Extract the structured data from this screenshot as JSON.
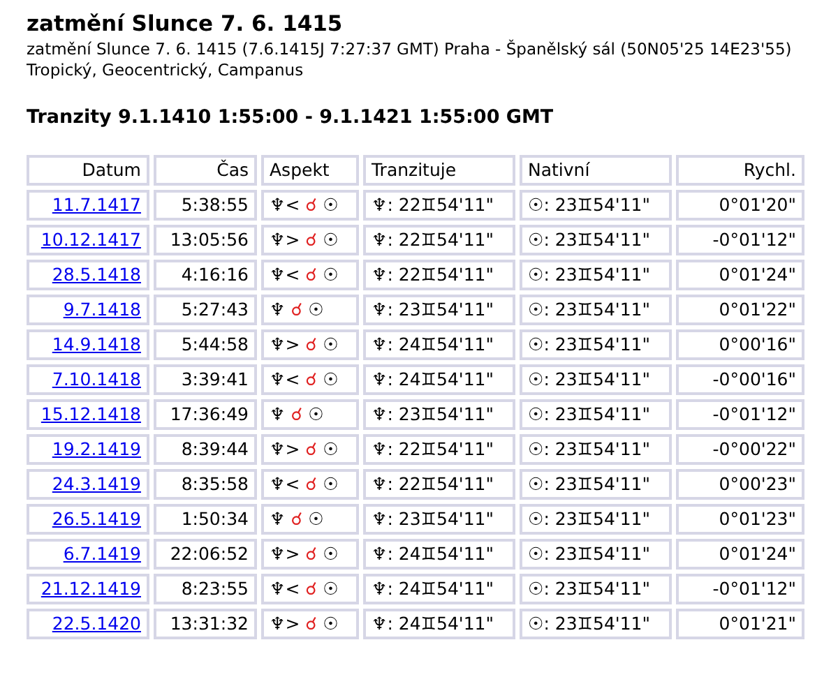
{
  "title": "zatmění Slunce 7. 6. 1415",
  "subtitle": "zatmění Slunce 7. 6. 1415 (7.6.1415J 7:27:37 GMT) Praha - Španělský sál (50N05'25 14E23'55)",
  "settings": "Tropický, Geocentrický, Campanus",
  "heading": "Tranzity 9.1.1410 1:55:00 - 9.1.1421 1:55:00 GMT",
  "table": {
    "columns": [
      "Datum",
      "Čas",
      "Aspekt",
      "Tranzituje",
      "Nativní",
      "Rychl."
    ],
    "rows": [
      {
        "date": "11.7.1417",
        "time": "5:38:55",
        "transit": "♆<",
        "aspect": "☌",
        "natal": "☉",
        "transiting": "♆: 22♊54'11\"",
        "native": "☉: 23♊54'11\"",
        "speed": "0°01'20\""
      },
      {
        "date": "10.12.1417",
        "time": "13:05:56",
        "transit": "♆>",
        "aspect": "☌",
        "natal": "☉",
        "transiting": "♆: 22♊54'11\"",
        "native": "☉: 23♊54'11\"",
        "speed": "-0°01'12\""
      },
      {
        "date": "28.5.1418",
        "time": "4:16:16",
        "transit": "♆<",
        "aspect": "☌",
        "natal": "☉",
        "transiting": "♆: 22♊54'11\"",
        "native": "☉: 23♊54'11\"",
        "speed": "0°01'24\""
      },
      {
        "date": "9.7.1418",
        "time": "5:27:43",
        "transit": "♆",
        "aspect": "☌",
        "natal": "☉",
        "transiting": "♆: 23♊54'11\"",
        "native": "☉: 23♊54'11\"",
        "speed": "0°01'22\""
      },
      {
        "date": "14.9.1418",
        "time": "5:44:58",
        "transit": "♆>",
        "aspect": "☌",
        "natal": "☉",
        "transiting": "♆: 24♊54'11\"",
        "native": "☉: 23♊54'11\"",
        "speed": "0°00'16\""
      },
      {
        "date": "7.10.1418",
        "time": "3:39:41",
        "transit": "♆<",
        "aspect": "☌",
        "natal": "☉",
        "transiting": "♆: 24♊54'11\"",
        "native": "☉: 23♊54'11\"",
        "speed": "-0°00'16\""
      },
      {
        "date": "15.12.1418",
        "time": "17:36:49",
        "transit": "♆",
        "aspect": "☌",
        "natal": "☉",
        "transiting": "♆: 23♊54'11\"",
        "native": "☉: 23♊54'11\"",
        "speed": "-0°01'12\""
      },
      {
        "date": "19.2.1419",
        "time": "8:39:44",
        "transit": "♆>",
        "aspect": "☌",
        "natal": "☉",
        "transiting": "♆: 22♊54'11\"",
        "native": "☉: 23♊54'11\"",
        "speed": "-0°00'22\""
      },
      {
        "date": "24.3.1419",
        "time": "8:35:58",
        "transit": "♆<",
        "aspect": "☌",
        "natal": "☉",
        "transiting": "♆: 22♊54'11\"",
        "native": "☉: 23♊54'11\"",
        "speed": "0°00'23\""
      },
      {
        "date": "26.5.1419",
        "time": "1:50:34",
        "transit": "♆",
        "aspect": "☌",
        "natal": "☉",
        "transiting": "♆: 23♊54'11\"",
        "native": "☉: 23♊54'11\"",
        "speed": "0°01'23\""
      },
      {
        "date": "6.7.1419",
        "time": "22:06:52",
        "transit": "♆>",
        "aspect": "☌",
        "natal": "☉",
        "transiting": "♆: 24♊54'11\"",
        "native": "☉: 23♊54'11\"",
        "speed": "0°01'24\""
      },
      {
        "date": "21.12.1419",
        "time": "8:23:55",
        "transit": "♆<",
        "aspect": "☌",
        "natal": "☉",
        "transiting": "♆: 24♊54'11\"",
        "native": "☉: 23♊54'11\"",
        "speed": "-0°01'12\""
      },
      {
        "date": "22.5.1420",
        "time": "13:31:32",
        "transit": "♆>",
        "aspect": "☌",
        "natal": "☉",
        "transiting": "♆: 24♊54'11\"",
        "native": "☉: 23♊54'11\"",
        "speed": "0°01'21\""
      }
    ]
  }
}
